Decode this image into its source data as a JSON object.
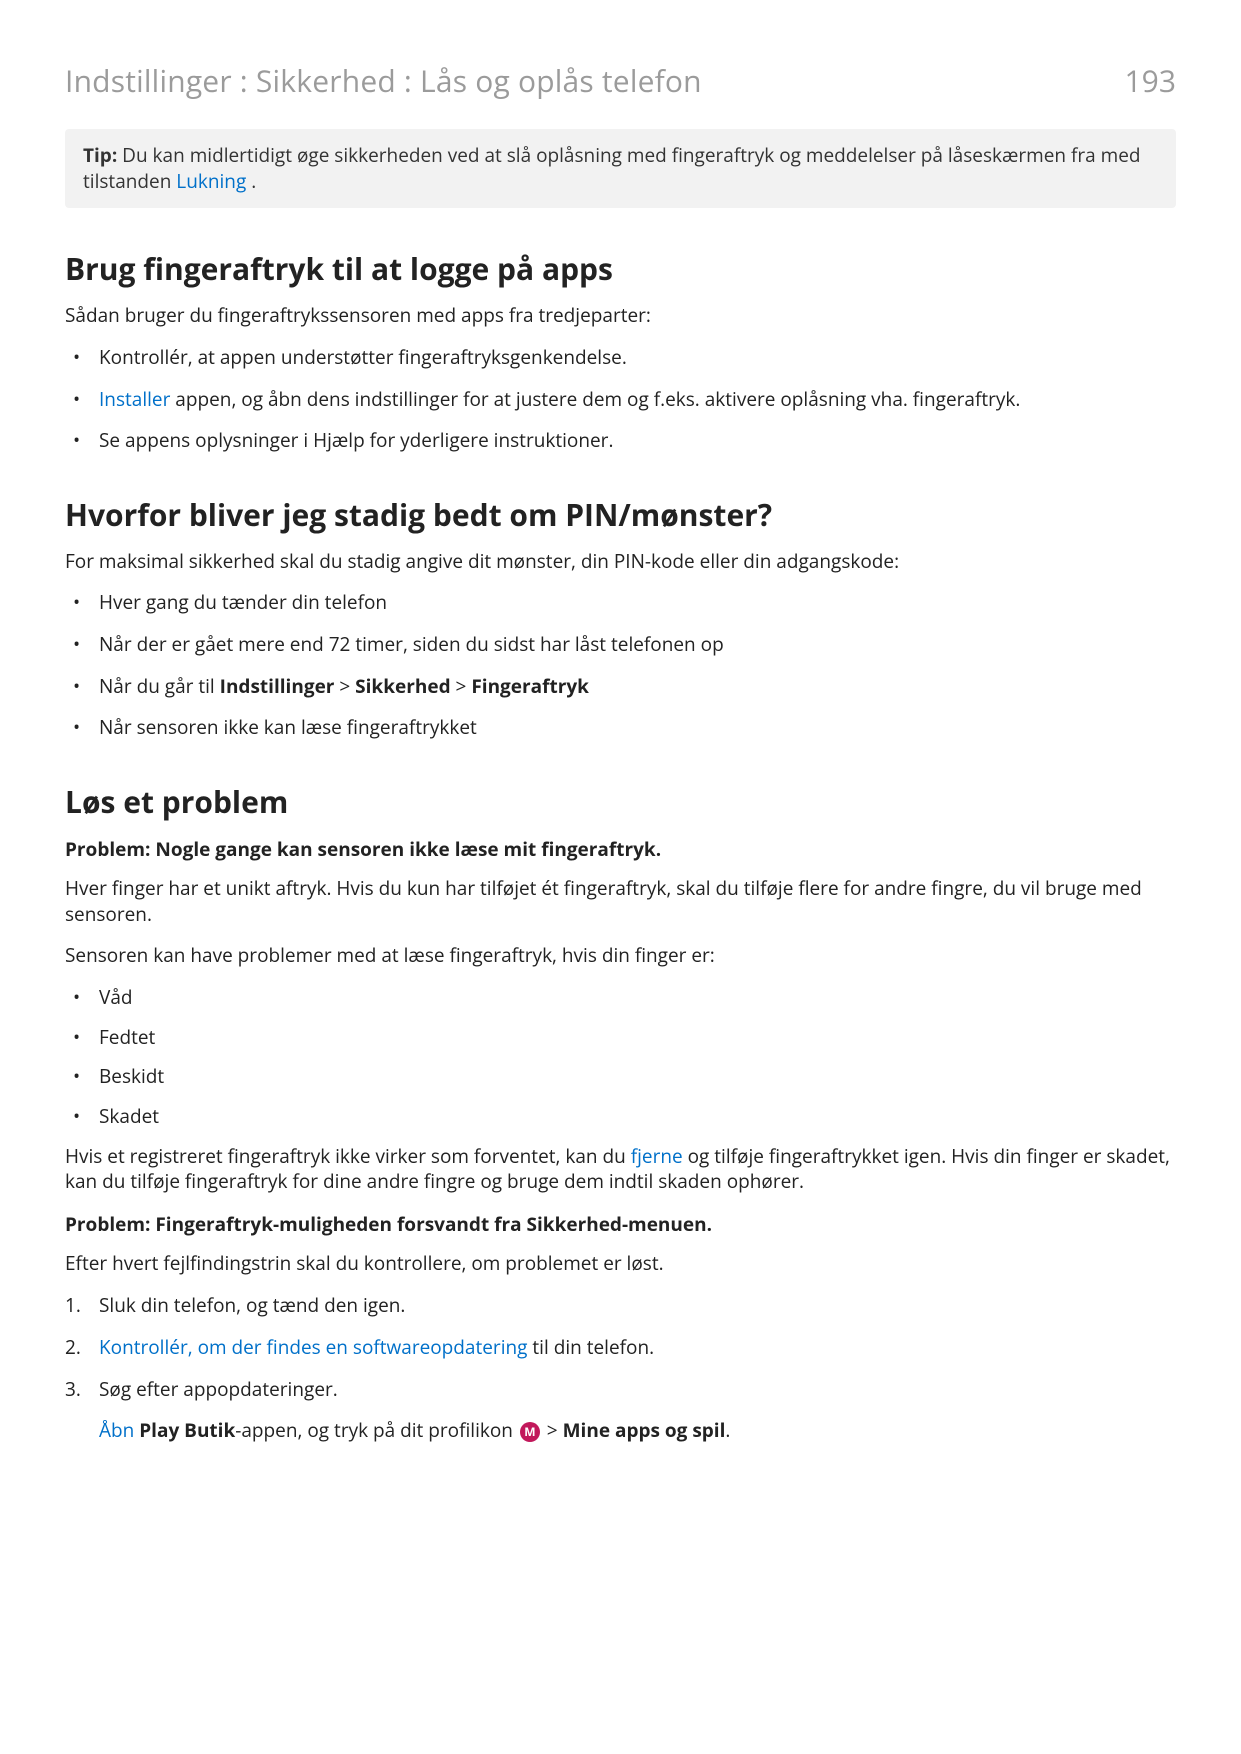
{
  "header": {
    "breadcrumb": "Indstillinger : Sikkerhed : Lås og oplås telefon",
    "page_number": "193"
  },
  "tip": {
    "label": "Tip:",
    "text_before_link": " Du kan midlertidigt øge sikkerheden ved at slå oplåsning med fingeraftryk og meddelelser på låseskærmen fra med tilstanden ",
    "link": "Lukning",
    "text_after_link": " ."
  },
  "section1": {
    "heading": "Brug fingeraftryk til at logge på apps",
    "intro": "Sådan bruger du fingeraftrykssensoren med apps fra tredjeparter:",
    "bullets": {
      "b1": "Kontrollér, at appen understøtter fingeraftryksgenkendelse.",
      "b2_link": "Installer",
      "b2_rest": " appen, og åbn dens indstillinger for at justere dem og f.eks. aktivere oplåsning vha. fingeraftryk.",
      "b3": "Se appens oplysninger i Hjælp for yderligere instruktioner."
    }
  },
  "section2": {
    "heading": "Hvorfor bliver jeg stadig bedt om PIN/mønster?",
    "intro": "For maksimal sikkerhed skal du stadig angive dit mønster, din PIN-kode eller din adgangskode:",
    "bullets": {
      "b1": "Hver gang du tænder din telefon",
      "b2": "Når der er gået mere end 72 timer, siden du sidst har låst telefonen op",
      "b3_pre": "Når du går til ",
      "b3_bold1": "Indstillinger",
      "b3_gt1": " > ",
      "b3_bold2": "Sikkerhed",
      "b3_gt2": " > ",
      "b3_bold3": "Fingeraftryk",
      "b4": "Når sensoren ikke kan læse fingeraftrykket"
    }
  },
  "section3": {
    "heading": "Løs et problem",
    "problem1_head": "Problem: Nogle gange kan sensoren ikke læse mit fingeraftryk.",
    "p1": "Hver finger har et unikt aftryk. Hvis du kun har tilføjet ét fingeraftryk, skal du tilføje flere for andre fingre, du vil bruge med sensoren.",
    "p2": "Sensoren kan have problemer med at læse fingeraftryk, hvis din finger er:",
    "bullets": {
      "b1": "Våd",
      "b2": "Fedtet",
      "b3": "Beskidt",
      "b4": "Skadet"
    },
    "p3_pre": "Hvis et registreret fingeraftryk ikke virker som forventet, kan du ",
    "p3_link": "fjerne",
    "p3_post": " og tilføje fingeraftrykket igen. Hvis din finger er skadet, kan du tilføje fingeraftryk for dine andre fingre og bruge dem indtil skaden ophører.",
    "problem2_head": "Problem: Fingeraftryk-muligheden forsvandt fra Sikkerhed-menuen.",
    "p4": "Efter hvert fejlfindingstrin skal du kontrollere, om problemet er løst.",
    "steps": {
      "s1": "Sluk din telefon, og tænd den igen.",
      "s2_link": "Kontrollér, om der findes en softwareopdatering",
      "s2_rest": " til din telefon.",
      "s3_main": "Søg efter appopdateringer.",
      "s3_extra_link": "Åbn",
      "s3_extra_bold": " Play Butik",
      "s3_extra_mid": "-appen, og tryk på dit profilikon ",
      "s3_icon_letter": "M",
      "s3_extra_gt": " > ",
      "s3_extra_bold2": "Mine apps og spil",
      "s3_extra_end": "."
    }
  }
}
